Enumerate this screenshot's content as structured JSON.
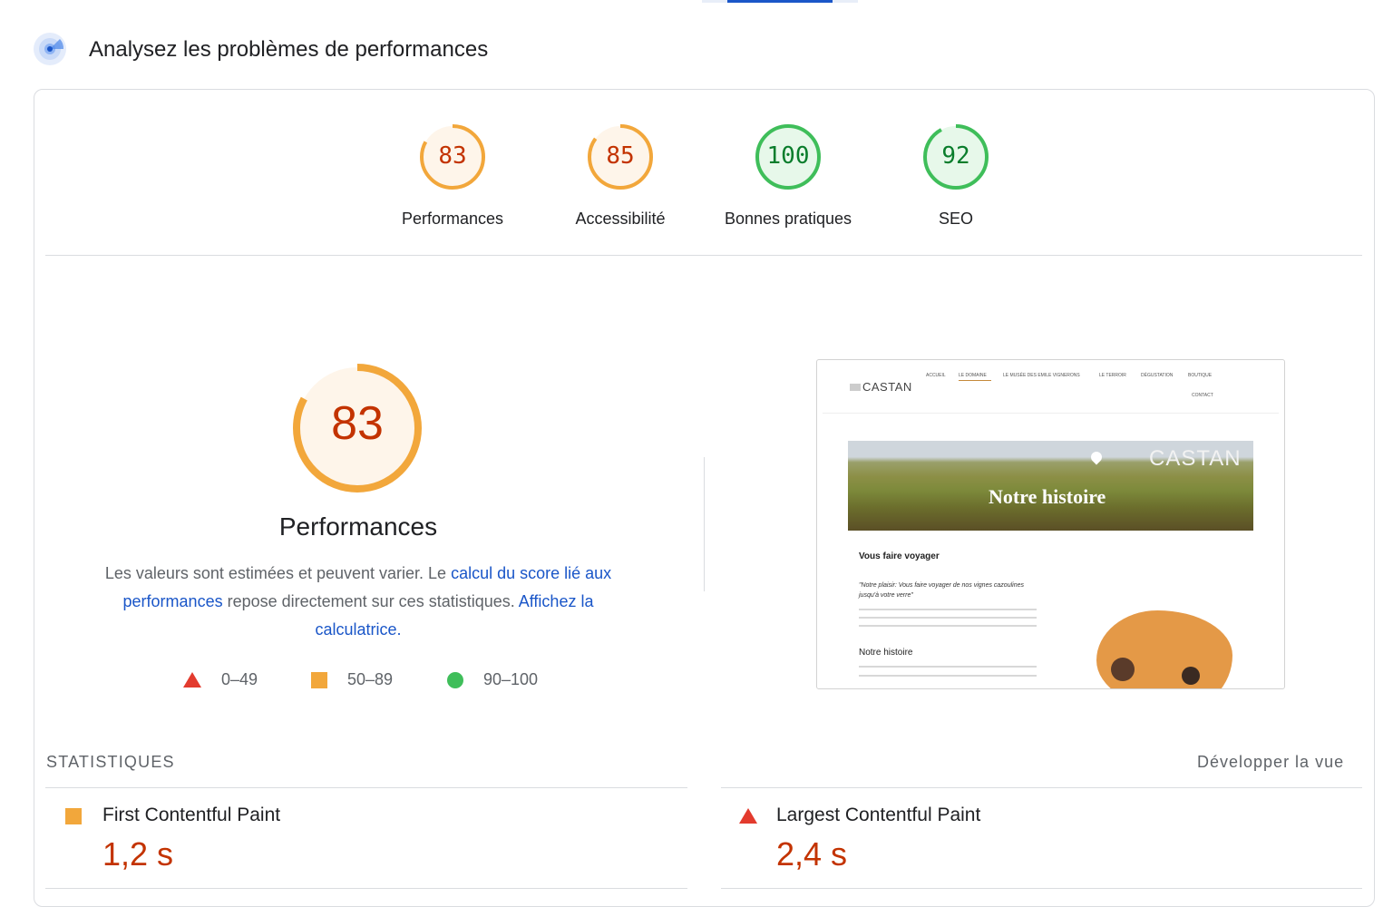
{
  "section_title": "Analysez les problèmes de performances",
  "categories": [
    {
      "label": "Performances",
      "score": "83",
      "value": 83,
      "status": "average"
    },
    {
      "label": "Accessibilité",
      "score": "85",
      "value": 85,
      "status": "average"
    },
    {
      "label": "Bonnes pratiques",
      "score": "100",
      "value": 100,
      "status": "pass"
    },
    {
      "label": "SEO",
      "score": "92",
      "value": 92,
      "status": "pass"
    }
  ],
  "main_gauge": {
    "score": "83",
    "value": 83,
    "title": "Performances"
  },
  "description": {
    "text1": "Les valeurs sont estimées et peuvent varier. Le ",
    "link1": "calcul du score lié aux performances",
    "text2": " repose directement sur ces statistiques. ",
    "link2": "Affichez la calculatrice."
  },
  "legend": [
    {
      "range": "0–49",
      "shape": "triangle-icon",
      "color": "#e33b2e"
    },
    {
      "range": "50–89",
      "shape": "square-icon",
      "color": "#f2a73b"
    },
    {
      "range": "90–100",
      "shape": "circle-icon",
      "color": "#3fbe5a"
    }
  ],
  "screenshot": {
    "logo": "CASTAN",
    "nav": [
      "ACCUEIL",
      "LE DOMAINE",
      "LE MUSÉE DES EMILE VIGNERONS",
      "LE TERROIR",
      "DÉGUSTATION",
      "BOUTIQUE",
      "CONTACT"
    ],
    "banner_title": "Notre histoire",
    "banner_logo": "CASTAN",
    "heading1": "Vous faire voyager",
    "quote": "\"Notre plaisir: Vous faire voyager de nos vignes cazoulines jusqu'à votre verre\"",
    "heading2": "Notre histoire"
  },
  "stats": {
    "title": "STATISTIQUES",
    "expand_label": "Développer la vue",
    "metrics": [
      {
        "label": "First Contentful Paint",
        "value": "1,2 s",
        "status": "average"
      },
      {
        "label": "Largest Contentful Paint",
        "value": "2,4 s",
        "status": "fail"
      }
    ]
  },
  "colors": {
    "average": "#f2a73b",
    "pass": "#3fbe5a",
    "fail": "#e33b2e",
    "link": "#1a56c8"
  }
}
